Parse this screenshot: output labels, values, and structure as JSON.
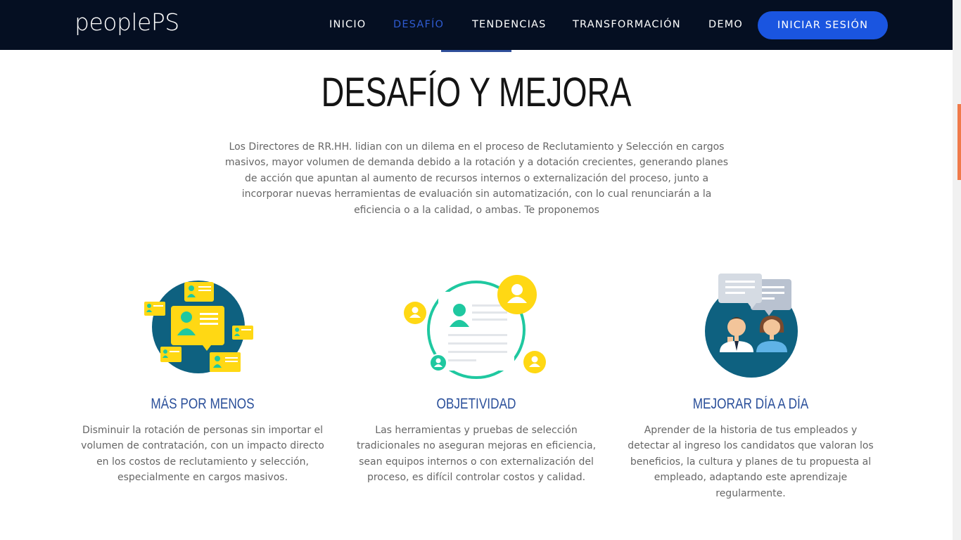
{
  "brand": {
    "logo_text": "peoplePS"
  },
  "nav": {
    "items": [
      {
        "label": "INICIO"
      },
      {
        "label": "DESAFÍO",
        "active": true
      },
      {
        "label": "TENDENCIAS"
      },
      {
        "label": "TRANSFORMACIÓN"
      },
      {
        "label": "DEMO"
      }
    ],
    "login_label": "INICIAR SESIÓN"
  },
  "section": {
    "title": "DESAFÍO Y MEJORA",
    "intro": "Los Directores de RR.HH. lidian con un dilema en el proceso de Reclutamiento y Selección en cargos masivos, mayor volumen de demanda debido a la rotación y a dotación crecientes, generando planes de acción que apuntan al aumento de recursos internos o externalización del proceso, junto a incorporar nuevas herramientas de evaluación sin automatización, con lo cual renunciarán a la eficiencia o a la calidad, o ambas. Te proponemos"
  },
  "features": [
    {
      "icon": "chat-profiles-icon",
      "title": "MÁS POR MENOS",
      "text": "Disminuir la rotación de personas sin importar el volumen de contratación, con un impacto directo en los costos de reclutamiento y selección, especialmente en cargos masivos."
    },
    {
      "icon": "resume-document-icon",
      "title": "OBJETIVIDAD",
      "text": "Las herramientas y pruebas de selección tradicionales no aseguran mejoras en eficiencia, sean equipos internos o con externalización del proceso, es difícil controlar costos y calidad."
    },
    {
      "icon": "team-conversation-icon",
      "title": "MEJORAR DÍA A DÍA",
      "text": "Aprender de la historia de tus empleados y detectar al ingreso los candidatos que valoran los beneficios, la cultura y planes de tu propuesta al empleado, adaptando este aprendizaje regularmente."
    }
  ],
  "colors": {
    "navbar_bg": "#050f22",
    "accent_blue": "#1a55e0",
    "heading_blue": "#2a4f9a",
    "teal_circle": "#0e6180",
    "yellow": "#ffd814",
    "mint": "#1fc8a0"
  }
}
